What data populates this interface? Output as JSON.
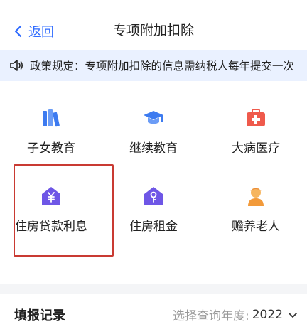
{
  "header": {
    "back_label": "返回",
    "title": "专项附加扣除"
  },
  "notice": {
    "text": "政策规定：专项附加扣除的信息需纳税人每年提交一次"
  },
  "deductions": [
    {
      "label": "子女教育",
      "icon": "books-icon",
      "color": "#3d7bf0"
    },
    {
      "label": "继续教育",
      "icon": "graduation-cap-icon",
      "color": "#3d7bf0"
    },
    {
      "label": "大病医疗",
      "icon": "medical-kit-icon",
      "color": "#ef5a4c"
    },
    {
      "label": "住房贷款利息",
      "icon": "house-yen-icon",
      "color": "#6e56e6"
    },
    {
      "label": "住房租金",
      "icon": "house-key-icon",
      "color": "#6e56e6"
    },
    {
      "label": "赡养老人",
      "icon": "elder-icon",
      "color": "#f29a3a"
    }
  ],
  "records": {
    "title": "填报记录",
    "year_placeholder": "选择查询年度:",
    "year_value": "2022"
  }
}
